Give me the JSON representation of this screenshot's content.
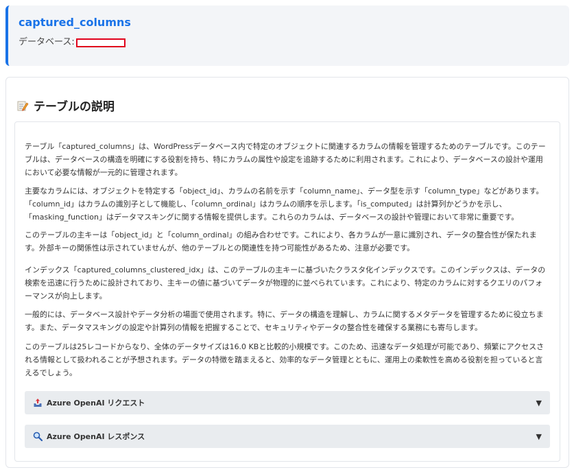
{
  "header": {
    "title": "captured_columns",
    "db_label": "データベース:"
  },
  "section": {
    "heading": "テーブルの説明",
    "heading_icon": "memo-pencil-icon"
  },
  "description": {
    "paragraphs": [
      "テーブル「captured_columns」は、WordPressデータベース内で特定のオブジェクトに関連するカラムの情報を管理するためのテーブルです。このテーブルは、データベースの構造を明確にする役割を持ち、特にカラムの属性や設定を追跡するために利用されます。これにより、データベースの設計や運用において必要な情報が一元的に管理されます。",
      "主要なカラムには、オブジェクトを特定する「object_id」、カラムの名前を示す「column_name」、データ型を示す「column_type」などがあります。「column_id」はカラムの識別子として機能し、「column_ordinal」はカラムの順序を示します。「is_computed」は計算列かどうかを示し、「masking_function」はデータマスキングに関する情報を提供します。これらのカラムは、データベースの設計や管理において非常に重要です。",
      "このテーブルの主キーは「object_id」と「column_ordinal」の組み合わせです。これにより、各カラムが一意に識別され、データの整合性が保たれます。外部キーの関係性は示されていませんが、他のテーブルとの関連性を持つ可能性があるため、注意が必要です。",
      "インデックス「captured_columns_clustered_idx」は、このテーブルの主キーに基づいたクラスタ化インデックスです。このインデックスは、データの検索を迅速に行うために設計されており、主キーの値に基づいてデータが物理的に並べられています。これにより、特定のカラムに対するクエリのパフォーマンスが向上します。",
      "一般的には、データベース設計やデータ分析の場面で使用されます。特に、データの構造を理解し、カラムに関するメタデータを管理するために役立ちます。また、データマスキングの設定や計算列の情報を把握することで、セキュリティやデータの整合性を確保する業務にも寄与します。",
      "このテーブルは25レコードからなり、全体のデータサイズは16.0 KBと比較的小規模です。このため、迅速なデータ処理が可能であり、頻繁にアクセスされる情報として扱われることが予想されます。データの特徴を踏まえると、効率的なデータ管理とともに、運用上の柔軟性を高める役割を担っていると言えるでしょう。"
    ]
  },
  "accordions": [
    {
      "label": "Azure OpenAI リクエスト",
      "icon": "outbox-tray-icon",
      "arrow": "▼"
    },
    {
      "label": "Azure OpenAI レスポンス",
      "icon": "magnifier-icon",
      "arrow": "▼"
    }
  ],
  "colors": {
    "accent": "#1a73e8",
    "redaction": "#e0001b",
    "accordion_bg": "#e9ecef"
  }
}
